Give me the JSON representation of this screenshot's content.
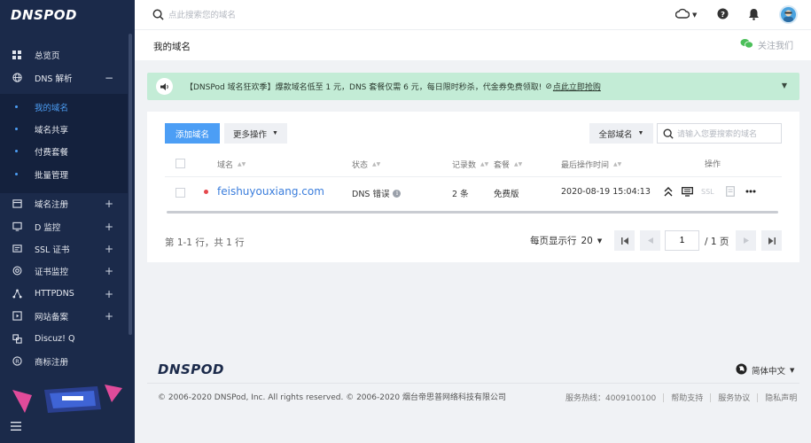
{
  "brand": {
    "logo": "DNSPOD"
  },
  "topbar": {
    "search_placeholder": "点此搜索您的域名"
  },
  "page": {
    "title": "我的域名",
    "follow": "关注我们"
  },
  "sidebar": {
    "items": [
      {
        "label": "总览页",
        "icon": "grid-icon",
        "sign": ""
      },
      {
        "label": "DNS 解析",
        "icon": "globe-icon",
        "sign": "−"
      }
    ],
    "subitems": [
      {
        "label": "我的域名",
        "active": true
      },
      {
        "label": "域名共享",
        "active": false
      },
      {
        "label": "付费套餐",
        "active": false
      },
      {
        "label": "批量管理",
        "active": false
      }
    ],
    "items2": [
      {
        "label": "域名注册",
        "icon": "calendar-icon",
        "sign": "+"
      },
      {
        "label": "D 监控",
        "icon": "monitor-icon",
        "sign": "+"
      },
      {
        "label": "SSL 证书",
        "icon": "certificate-icon",
        "sign": "+"
      },
      {
        "label": "证书监控",
        "icon": "target-icon",
        "sign": "+"
      },
      {
        "label": "HTTPDNS",
        "icon": "network-icon",
        "sign": "+"
      },
      {
        "label": "网站备案",
        "icon": "record-icon",
        "sign": "+"
      },
      {
        "label": "Discuz! Q",
        "icon": "discuz-icon",
        "sign": ""
      },
      {
        "label": "商标注册",
        "icon": "registered-icon",
        "sign": ""
      }
    ]
  },
  "banner": {
    "text": "【DNSPod 域名狂欢季】爆款域名低至 1 元，DNS 套餐仅需 6 元，每日限时秒杀，代金券免费领取!",
    "link": "点此立即抢购"
  },
  "toolbar": {
    "add_domain": "添加域名",
    "more_actions": "更多操作",
    "filter": "全部域名",
    "search_placeholder": "请输入您要搜索的域名"
  },
  "table": {
    "headers": {
      "domain": "域名",
      "status": "状态",
      "records": "记录数",
      "plan": "套餐",
      "last_op": "最后操作时间",
      "actions": "操作"
    },
    "rows": [
      {
        "domain": "feishuyouxiang.com",
        "status": "DNS 错误",
        "records": "2 条",
        "plan": "免费版",
        "last_op": "2020-08-19 15:04:13",
        "ssl": "SSL"
      }
    ]
  },
  "pagination": {
    "info": "第 1-1 行，共 1 行",
    "page_size_label": "每页显示行",
    "page_size": "20",
    "current": "1",
    "total": "/ 1 页"
  },
  "footer": {
    "logo": "DNSPOD",
    "language": "简体中文",
    "copyright": "© 2006-2020 DNSPod, Inc. All rights reserved. © 2006-2020 烟台帝思普网络科技有限公司",
    "hotline": "服务热线：4009100100",
    "support": "帮助支持",
    "agreement": "服务协议",
    "privacy": "隐私声明"
  },
  "colors": {
    "sidebar_bg": "#1b2a4a",
    "primary": "#4c9ef5",
    "banner_bg": "#c3ecd6",
    "error_dot": "#e5484d"
  }
}
